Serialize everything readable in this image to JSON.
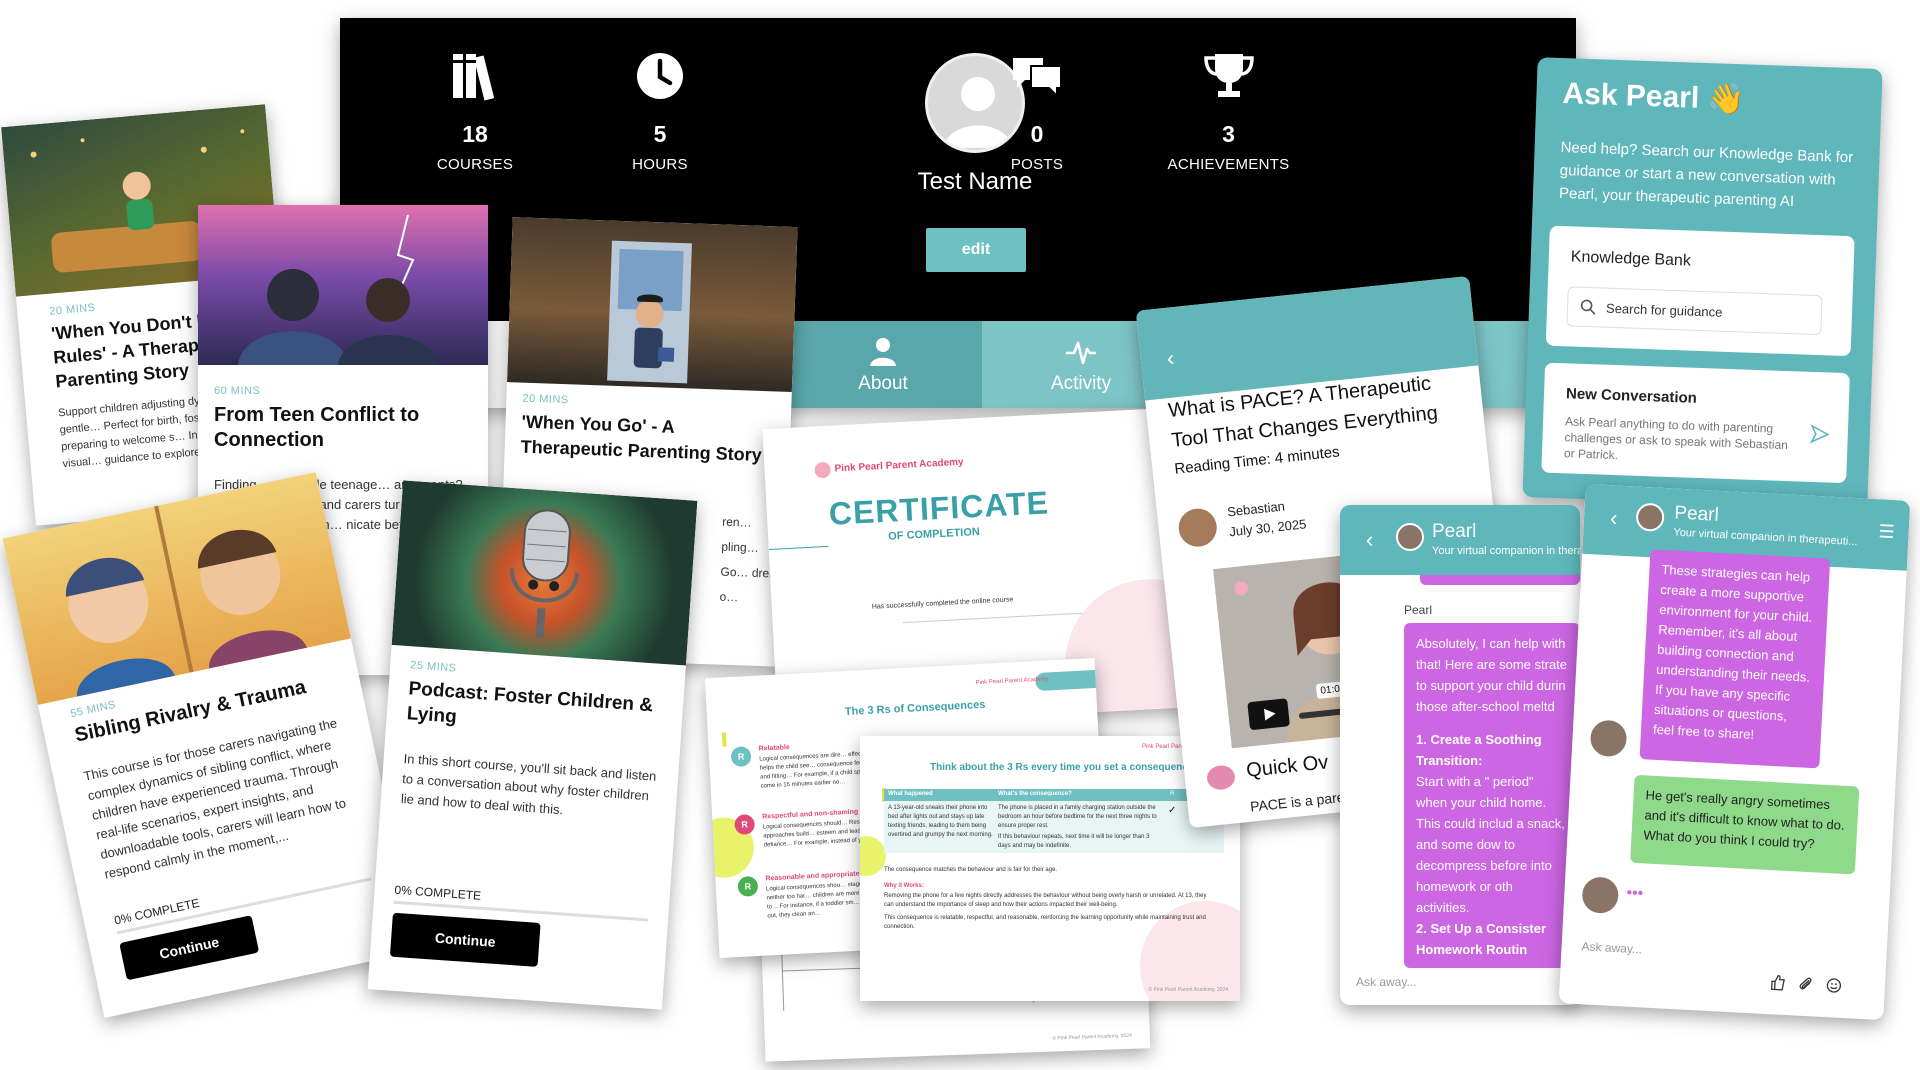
{
  "profile": {
    "stats": [
      {
        "value": "18",
        "label": "COURSES",
        "icon": "books-icon"
      },
      {
        "value": "5",
        "label": "HOURS",
        "icon": "clock-icon"
      },
      {
        "value": "0",
        "label": "POSTS",
        "icon": "chat-bubbles-icon"
      },
      {
        "value": "3",
        "label": "ACHIEVEMENTS",
        "icon": "trophy-icon"
      }
    ],
    "name": "Test Name",
    "edit_label": "edit",
    "tabs": [
      {
        "label": "About"
      },
      {
        "label": "Activity"
      }
    ]
  },
  "courses": [
    {
      "mins": "20 MINS",
      "title": "'When You Don't K… Rules' - A Therape… Parenting Story",
      "desc": "Support children adjusting dynamics with this gentle… Perfect for birth, foster, or… preparing to welcome s… Includes prompts, visual… guidance to explore rule…"
    },
    {
      "mins": "60 MINS",
      "title": "From Teen Conflict to Connection",
      "desc": "Finding… to handle teenage… arguments? This cou… arents and carers tur… nderstanding. Learn… nicate better, unde… s, and build a c…"
    },
    {
      "mins": "20 MINS",
      "title": "'When You Go' - A Therapeutic Parenting Story",
      "desc": "ren… pling… Go… dren o…"
    },
    {
      "mins": "55 MINS",
      "title": "Sibling Rivalry & Trauma",
      "desc": "This course is for those carers navigating the complex dynamics of sibling conflict, where children have experienced trauma. Through real-life scenarios, expert insights, and downloadable tools, carers will learn how to respond calmly in the moment,...",
      "pct": "0% COMPLETE",
      "button": "Continue"
    },
    {
      "mins": "25 MINS",
      "title": "Podcast: Foster Children & Lying",
      "desc": "In this short course, you'll sit back and listen to a conversation about why foster children lie and how to deal with this.",
      "pct": "0% COMPLETE",
      "button": "Continue"
    }
  ],
  "certificate": {
    "brand": "Pink Pearl Parent Academy",
    "title": "CERTIFICATE",
    "subtitle": "OF COMPLETION",
    "line": "Has successfully completed the online course"
  },
  "worksheet1": {
    "brand": "Pink Pearl Parent Academy",
    "title": "The 3 Rs of Consequences",
    "items": [
      {
        "letter": "R",
        "heading": "Relatable",
        "text": "Logical consequences are dire… effect. This helps the child see… consequence feel fair and fitting… For example, if a child spills ju… come in 15 minutes earlier no…"
      },
      {
        "letter": "R",
        "heading": "Respectful and non-shaming",
        "text": "Logical consequences should… Respectful approaches build… esteem and lead to defiance… For example, instead of yelli…"
      },
      {
        "letter": "R",
        "heading": "Reasonable and appropriate",
        "text": "Logical consequences shou… stage, being neither too har… children are more likely to… For instance, if a toddler sm… their bike out, they clean an…"
      }
    ]
  },
  "worksheet2": {
    "brand": "Pink Pearl Parent Aca…",
    "title": "Think about the 3 Rs every time you set a consequence",
    "col1": "What happened",
    "col2": "What's the consequence?",
    "r": "R",
    "row1": "A 13-year-old sneaks their phone into bed after lights out and stays up late texting friends, leading to them being overtired and grumpy the next morning.",
    "row2": "The phone is placed in a family charging station outside the bedroom an hour before bedtime for the next three nights to ensure proper rest.",
    "row2b": "If this behaviour repeats, next time it will be longer than 3 days and may be indefinite.",
    "check": "✓",
    "note1": "The consequence matches the behaviour and is fair for their age.",
    "why": "Why it Works:",
    "note2": "Removing the phone for a few nights directly addresses the behaviour without being overly harsh or unrelated. At 13, they can understand the importance of sleep and how their actions impacted their well-being.",
    "note3": "This consequence is relatable, respectful, and reasonable, reinforcing the learning opportunity while maintaining trust and connection.",
    "footer": "© Pink Pearl Parent Academy, 2024"
  },
  "worksheet3": {
    "footer": "© Pink Pearl Parent Academy, 2024"
  },
  "ask": {
    "title": "Ask Pearl",
    "emoji": "👋",
    "sub": "Need help? Search our Knowledge Bank for guidance or start a new conversation with Pearl, your therapeutic parenting AI",
    "kb_title": "Knowledge Bank",
    "kb_placeholder": "Search for guidance",
    "nc_title": "New Conversation",
    "nc_text": "Ask Pearl anything to do with parenting challenges or ask to speak with Sebastian or Patrick."
  },
  "blog": {
    "back": "‹",
    "title": "What is PACE? A Therapeutic Tool That Changes Everything",
    "reading": "Reading Time: 4 minutes",
    "author": "Sebastian",
    "date": "July 30, 2025",
    "duration": "01:08",
    "quick": "Quick Ov",
    "pace": "PACE is a pare"
  },
  "chat1": {
    "back": "‹",
    "name": "Pearl",
    "sub": "Your virtual companion in thera",
    "sender": "Pearl",
    "msg_a": "Absolutely, I can help with that! Here are some strate to support your child durin those after-school meltd",
    "msg_b1": "1. Create a Soothing Transition:",
    "msg_b2": "Start with a \" period\" when your child home. This could includ a snack, and some dow to decompress before into homework or oth activities.",
    "msg_c": "2. Set Up a Consister Homework Routin",
    "input": "Ask away..."
  },
  "chat2": {
    "back": "‹",
    "name": "Pearl",
    "sub": "Your virtual companion in therapeuti...",
    "menu": "☰",
    "msg1": "These strategies can help create a more supportive environment for your child. Remember, it's all about building connection and understanding their needs. If you have any specific situations or questions, feel free to share!",
    "msg2": "He get's really angry sometimes and it's difficult to know what to do. What do you think I could try?",
    "typing": "•••",
    "input": "Ask away..."
  },
  "colors": {
    "teal": "#5fb7bb",
    "teal_light": "#7dc4c6",
    "purple": "#cc66e3",
    "green": "#8fd98a",
    "pink": "#e04a7a"
  }
}
